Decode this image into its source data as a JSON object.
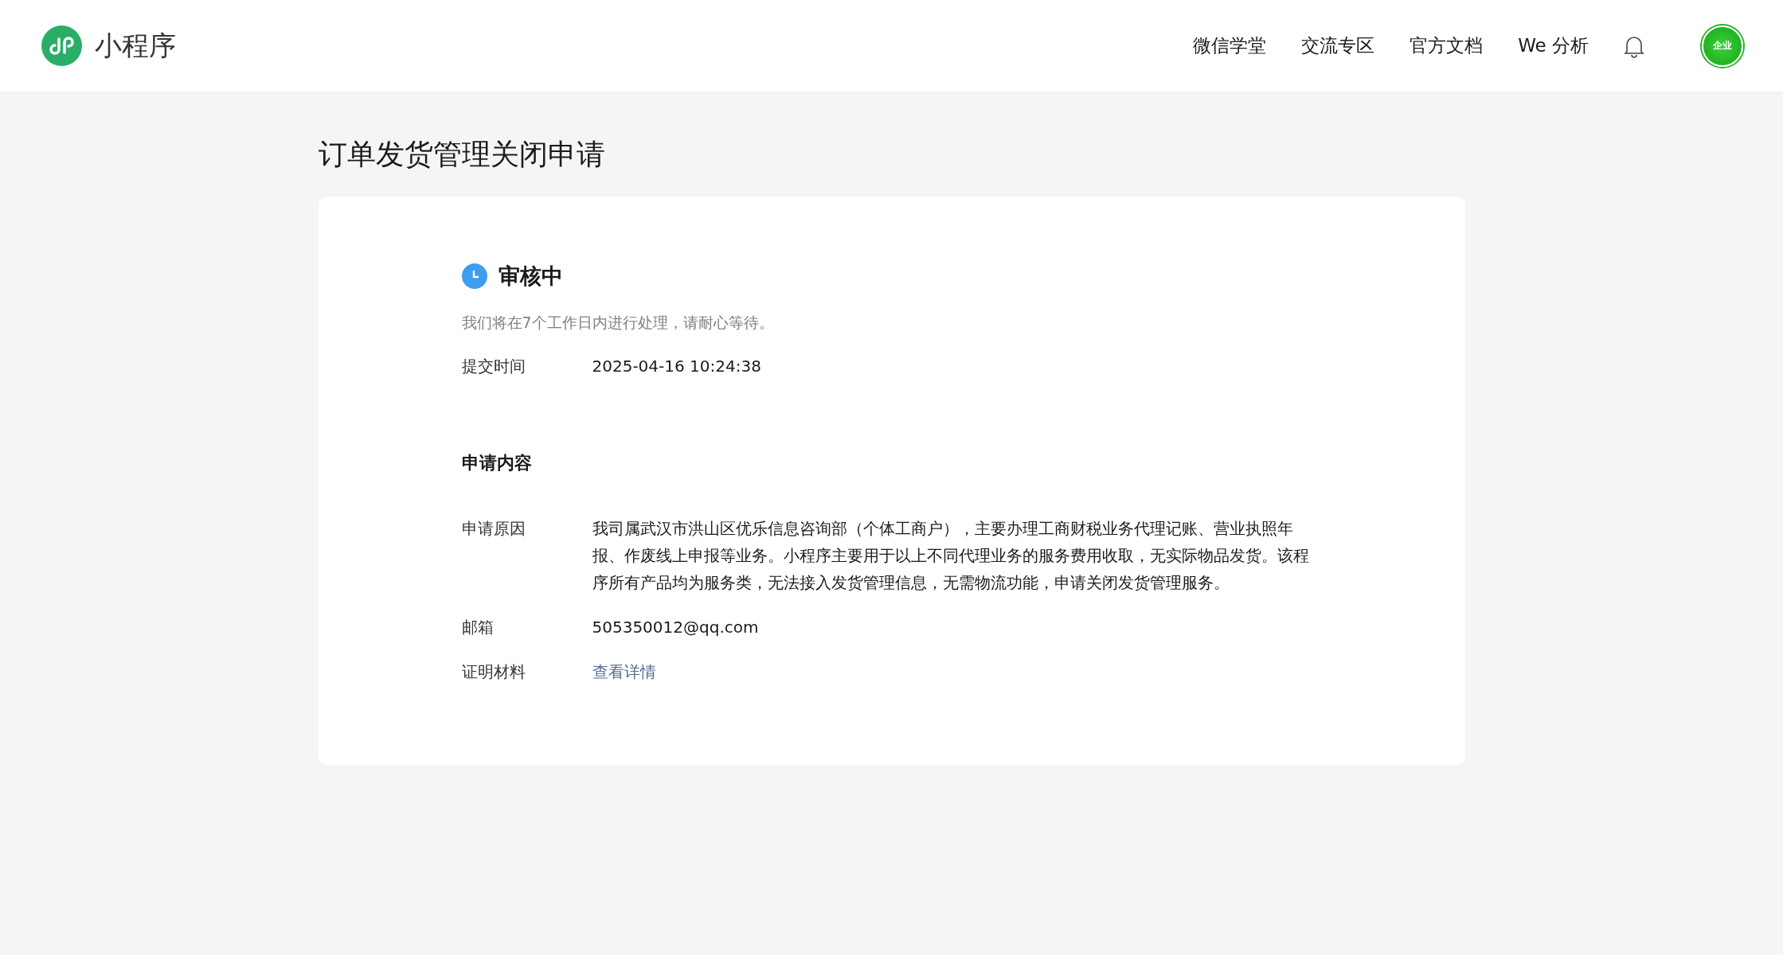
{
  "header": {
    "logo_text": "小程序",
    "nav": [
      {
        "label": "微信学堂"
      },
      {
        "label": "交流专区"
      },
      {
        "label": "官方文档"
      },
      {
        "label": "We 分析"
      }
    ],
    "avatar_badge": "企业"
  },
  "page_title": "订单发货管理关闭申请",
  "status": {
    "kind": "reviewing",
    "title": "审核中",
    "note": "我们将在7个工作日内进行处理，请耐心等待。"
  },
  "submit": {
    "label": "提交时间",
    "value": "2025-04-16 10:24:38"
  },
  "section_title": "申请内容",
  "fields": [
    {
      "kind": "text",
      "label": "申请原因",
      "value": "我司属武汉市洪山区优乐信息咨询部（个体工商户），主要办理工商财税业务代理记账、营业执照年报、作废线上申报等业务。小程序主要用于以上不同代理业务的服务费用收取，无实际物品发货。该程序所有产品均为服务类，无法接入发货管理信息，无需物流功能，申请关闭发货管理服务。"
    },
    {
      "kind": "text",
      "label": "邮箱",
      "value": "505350012@qq.com"
    },
    {
      "kind": "link",
      "label": "证明材料",
      "value": "查看详情"
    }
  ]
}
